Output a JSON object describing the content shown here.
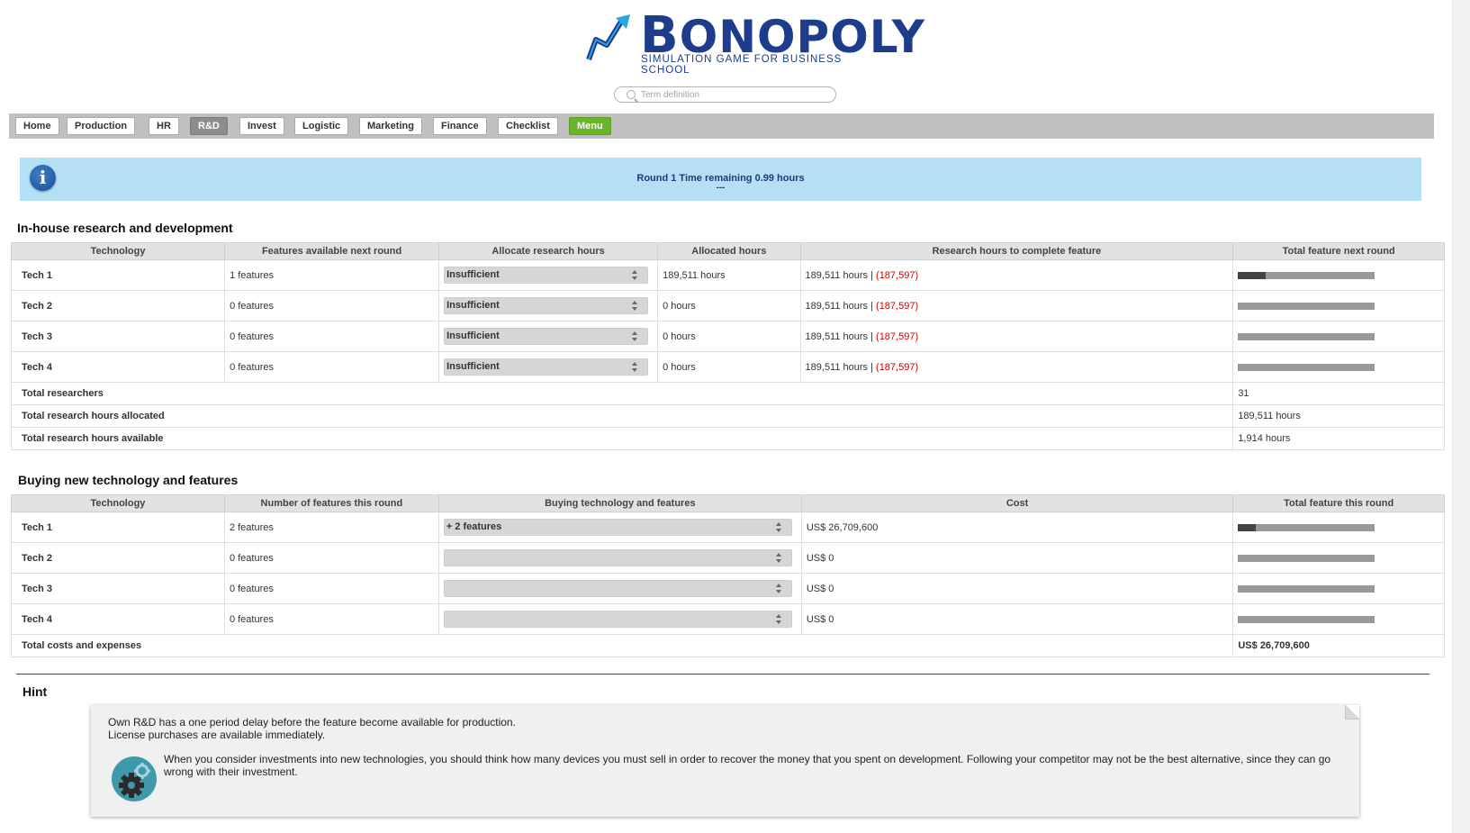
{
  "brand": {
    "name_first": "B",
    "name_rest": "ONOPOLY",
    "tagline": "SIMULATION GAME FOR BUSINESS SCHOOL"
  },
  "search": {
    "placeholder": "Term definition"
  },
  "nav": {
    "items": [
      "Home",
      "Production",
      "HR",
      "R&D",
      "Invest",
      "Logistic",
      "Marketing",
      "Finance",
      "Checklist",
      "Menu"
    ],
    "active": "R&D"
  },
  "banner": {
    "text": "Round 1 Time remaining 0.99 hours",
    "sub": "---"
  },
  "inhouse": {
    "title": "In-house research and development",
    "headers": [
      "Technology",
      "Features available next round",
      "Allocate research hours",
      "Allocated hours",
      "Research hours to complete feature",
      "Total feature next round"
    ],
    "rows": [
      {
        "tech": "Tech 1",
        "features": "1 features",
        "allocate": "Insufficient",
        "allocated": "189,511 hours",
        "to_complete": "189,511 hours |",
        "deficit": "(187,597)",
        "progress": 0.2
      },
      {
        "tech": "Tech 2",
        "features": "0 features",
        "allocate": "Insufficient",
        "allocated": "0 hours",
        "to_complete": "189,511 hours |",
        "deficit": "(187,597)",
        "progress": 0
      },
      {
        "tech": "Tech 3",
        "features": "0 features",
        "allocate": "Insufficient",
        "allocated": "0 hours",
        "to_complete": "189,511 hours |",
        "deficit": "(187,597)",
        "progress": 0
      },
      {
        "tech": "Tech 4",
        "features": "0 features",
        "allocate": "Insufficient",
        "allocated": "0 hours",
        "to_complete": "189,511 hours |",
        "deficit": "(187,597)",
        "progress": 0
      }
    ],
    "summary": [
      {
        "label": "Total researchers",
        "value": "31"
      },
      {
        "label": "Total research hours allocated",
        "value": "189,511 hours"
      },
      {
        "label": "Total research hours available",
        "value": "1,914 hours"
      }
    ]
  },
  "buying": {
    "title": "Buying new technology and features",
    "headers": [
      "Technology",
      "Number of features this round",
      "Buying technology and features",
      "Cost",
      "Total feature this round"
    ],
    "rows": [
      {
        "tech": "Tech 1",
        "features": "2 features",
        "buy": "+ 2 features",
        "cost": "US$ 26,709,600",
        "progress": 0.13
      },
      {
        "tech": "Tech 2",
        "features": "0 features",
        "buy": "",
        "cost": "US$ 0",
        "progress": 0
      },
      {
        "tech": "Tech 3",
        "features": "0 features",
        "buy": "",
        "cost": "US$ 0",
        "progress": 0
      },
      {
        "tech": "Tech 4",
        "features": "0 features",
        "buy": "",
        "cost": "US$ 0",
        "progress": 0
      }
    ],
    "total_label": "Total costs and expenses",
    "total_value": "US$ 26,709,600"
  },
  "hint": {
    "title": "Hint",
    "line1": "Own R&D has a one period delay before the feature become available for production.",
    "line2": "License purchases are available immediately.",
    "paragraph": "When you consider investments into new technologies, you should think how many devices you must sell in order to recover the money that you spent on development. Following your competitor may not be the best alternative, since they can go wrong with their investment."
  },
  "colors": {
    "brand_blue": "#1e3c8c",
    "banner_bg": "#b4dff5",
    "menu_green": "#6ab42a",
    "deficit_red": "#d40000"
  }
}
